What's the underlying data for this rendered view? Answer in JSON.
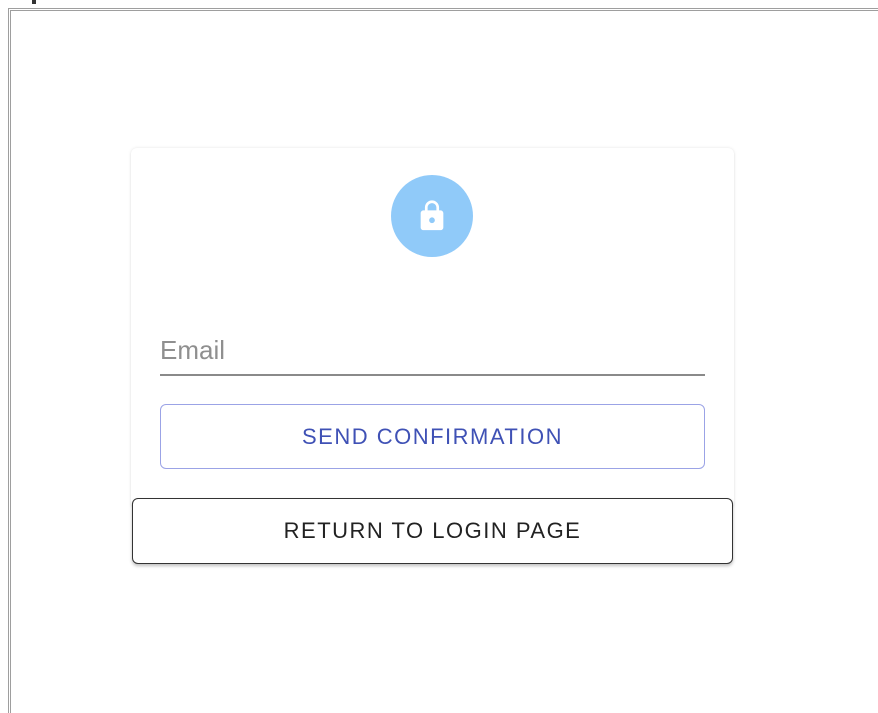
{
  "card": {
    "lock_icon": "lock-icon",
    "avatar_color": "#90caf9",
    "email": {
      "placeholder": "Email",
      "value": ""
    },
    "send_label": "SEND CONFIRMATION",
    "send_color": "#3f51b5"
  },
  "footer": {
    "return_label": "RETURN TO LOGIN PAGE"
  }
}
